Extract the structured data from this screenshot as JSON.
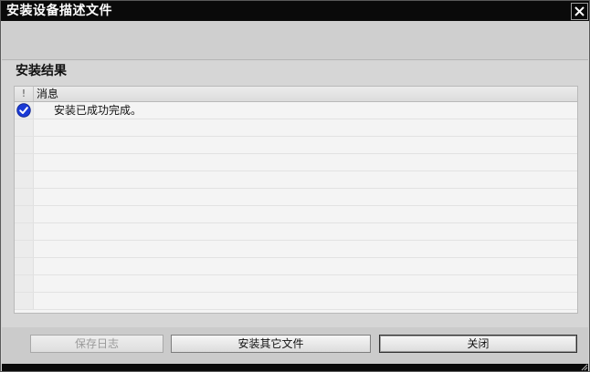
{
  "window": {
    "title": "安装设备描述文件",
    "close_glyph": "✕"
  },
  "section": {
    "title": "安装结果"
  },
  "grid": {
    "columns": {
      "icon": "!",
      "message": "消息"
    },
    "rows": [
      {
        "icon": "check-circle-icon",
        "message": "安装已成功完成。"
      },
      {
        "icon": "",
        "message": ""
      },
      {
        "icon": "",
        "message": ""
      },
      {
        "icon": "",
        "message": ""
      },
      {
        "icon": "",
        "message": ""
      },
      {
        "icon": "",
        "message": ""
      },
      {
        "icon": "",
        "message": ""
      },
      {
        "icon": "",
        "message": ""
      },
      {
        "icon": "",
        "message": ""
      },
      {
        "icon": "",
        "message": ""
      },
      {
        "icon": "",
        "message": ""
      },
      {
        "icon": "",
        "message": ""
      }
    ]
  },
  "buttons": {
    "save_log": "保存日志",
    "install_other": "安装其它文件",
    "close": "关闭",
    "save_log_enabled": false
  },
  "colors": {
    "titlebar": "#0a0a0a",
    "check_icon": "#1a3bd6"
  }
}
